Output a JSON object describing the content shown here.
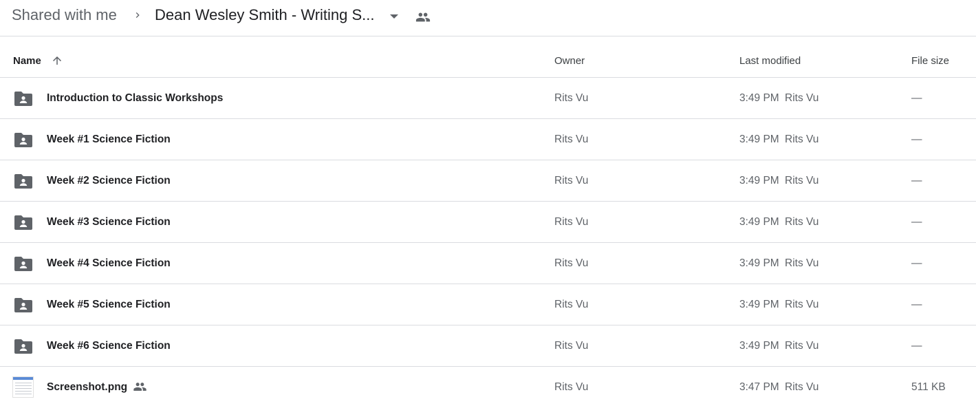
{
  "breadcrumb": {
    "root": "Shared with me",
    "current": "Dean Wesley Smith - Writing S..."
  },
  "columns": {
    "name": "Name",
    "owner": "Owner",
    "last_modified": "Last modified",
    "file_size": "File size"
  },
  "rows": [
    {
      "name": "Introduction to Classic Workshops",
      "type": "shared-folder",
      "owner": "Rits Vu",
      "modified_time": "3:49 PM",
      "modified_by": "Rits Vu",
      "size": "—"
    },
    {
      "name": "Week #1 Science Fiction",
      "type": "shared-folder",
      "owner": "Rits Vu",
      "modified_time": "3:49 PM",
      "modified_by": "Rits Vu",
      "size": "—"
    },
    {
      "name": "Week #2 Science Fiction",
      "type": "shared-folder",
      "owner": "Rits Vu",
      "modified_time": "3:49 PM",
      "modified_by": "Rits Vu",
      "size": "—"
    },
    {
      "name": "Week #3 Science Fiction",
      "type": "shared-folder",
      "owner": "Rits Vu",
      "modified_time": "3:49 PM",
      "modified_by": "Rits Vu",
      "size": "—"
    },
    {
      "name": "Week #4 Science Fiction",
      "type": "shared-folder",
      "owner": "Rits Vu",
      "modified_time": "3:49 PM",
      "modified_by": "Rits Vu",
      "size": "—"
    },
    {
      "name": "Week #5 Science Fiction",
      "type": "shared-folder",
      "owner": "Rits Vu",
      "modified_time": "3:49 PM",
      "modified_by": "Rits Vu",
      "size": "—"
    },
    {
      "name": "Week #6 Science Fiction",
      "type": "shared-folder",
      "owner": "Rits Vu",
      "modified_time": "3:49 PM",
      "modified_by": "Rits Vu",
      "size": "—"
    },
    {
      "name": "Screenshot.png",
      "type": "image-file",
      "owner": "Rits Vu",
      "modified_time": "3:47 PM",
      "modified_by": "Rits Vu",
      "size": "511 KB"
    }
  ],
  "icons": {
    "breadcrumb_separator": "chevron-right-icon",
    "dropdown": "arrow-drop-down-icon",
    "shared": "people-icon",
    "sort": "arrow-up-icon",
    "folder": "shared-folder-icon"
  },
  "colors": {
    "icon_gray": "#5f6368",
    "divider": "#dadce0",
    "text_primary": "#202124"
  }
}
